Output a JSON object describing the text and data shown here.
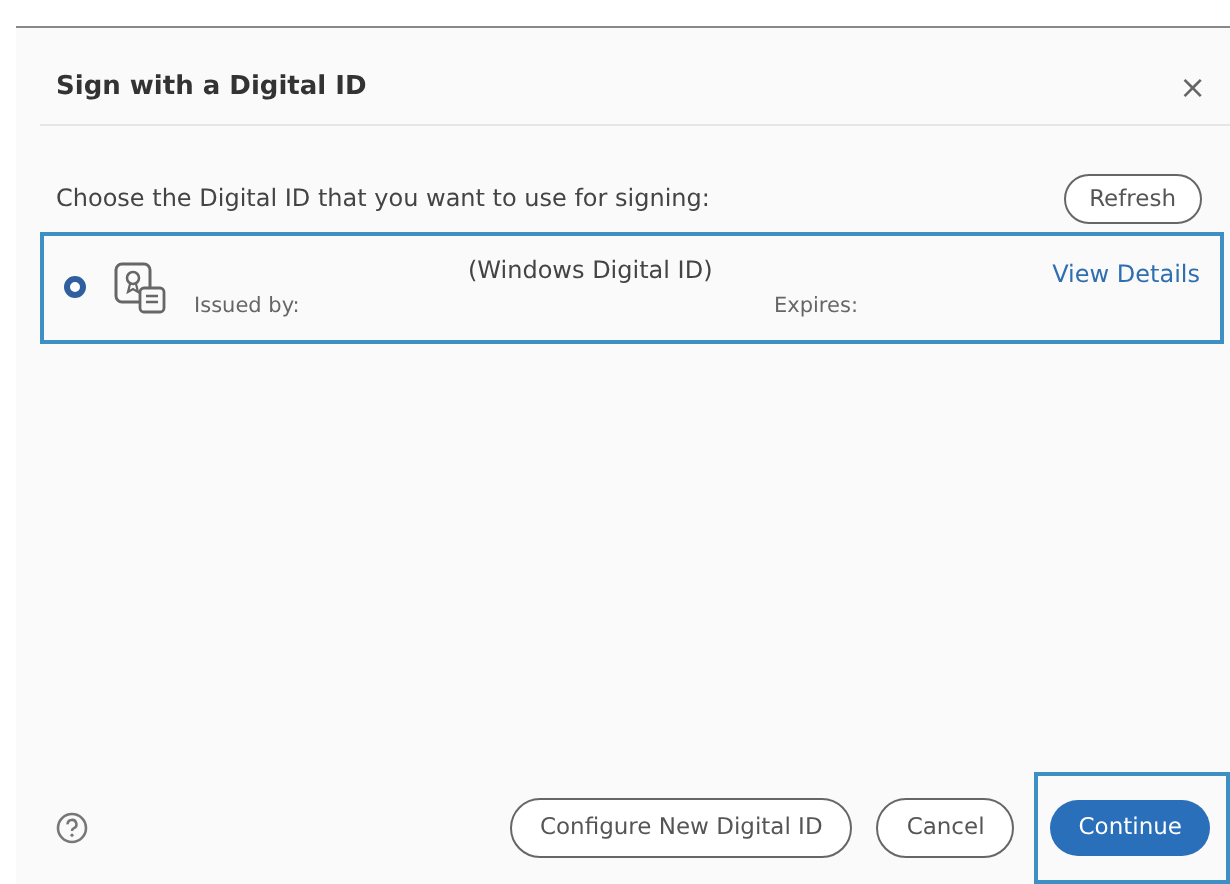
{
  "dialog": {
    "title": "Sign with a Digital ID",
    "close": "×"
  },
  "prompt": "Choose the Digital ID that you want to use for signing:",
  "refresh_button": "Refresh",
  "digital_ids": [
    {
      "name": "(Windows Digital ID)",
      "issued_by_label": "Issued by:",
      "expires_label": "Expires:",
      "details_link": "View Details",
      "selected": true,
      "highlighted": true
    }
  ],
  "buttons": [
    {
      "label": "Configure New Digital ID",
      "kind": "outline",
      "highlighted": false
    },
    {
      "label": "Cancel",
      "kind": "outline",
      "highlighted": false
    },
    {
      "label": "Continue",
      "kind": "primary",
      "highlighted": true
    }
  ]
}
